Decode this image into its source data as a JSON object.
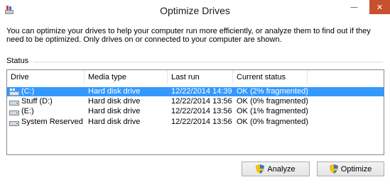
{
  "window": {
    "title": "Optimize Drives",
    "minimize_glyph": "—",
    "close_glyph": "✕"
  },
  "intro": "You can optimize your drives to help your computer run more efficiently, or analyze them to find out if they need to be optimized. Only drives on or connected to your computer are shown.",
  "status": {
    "label": "Status",
    "columns": [
      "Drive",
      "Media type",
      "Last run",
      "Current status"
    ],
    "rows": [
      {
        "drive": "(C:)",
        "media": "Hard disk drive",
        "last_run": "12/22/2014 14:39",
        "status": "OK (2% fragmented)",
        "icon": "windows-drive-icon",
        "selected": true
      },
      {
        "drive": "Stuff (D:)",
        "media": "Hard disk drive",
        "last_run": "12/22/2014 13:56",
        "status": "OK (0% fragmented)",
        "icon": "hard-drive-icon",
        "selected": false
      },
      {
        "drive": "(E:)",
        "media": "Hard disk drive",
        "last_run": "12/22/2014 13:56",
        "status": "OK (1% fragmented)",
        "icon": "hard-drive-icon",
        "selected": false
      },
      {
        "drive": "System Reserved",
        "media": "Hard disk drive",
        "last_run": "12/22/2014 13:56",
        "status": "OK (0% fragmented)",
        "icon": "hard-drive-icon",
        "selected": false
      }
    ]
  },
  "buttons": {
    "analyze": "Analyze",
    "optimize": "Optimize"
  },
  "colors": {
    "selection": "#3399ff",
    "close_button": "#c7502f"
  }
}
